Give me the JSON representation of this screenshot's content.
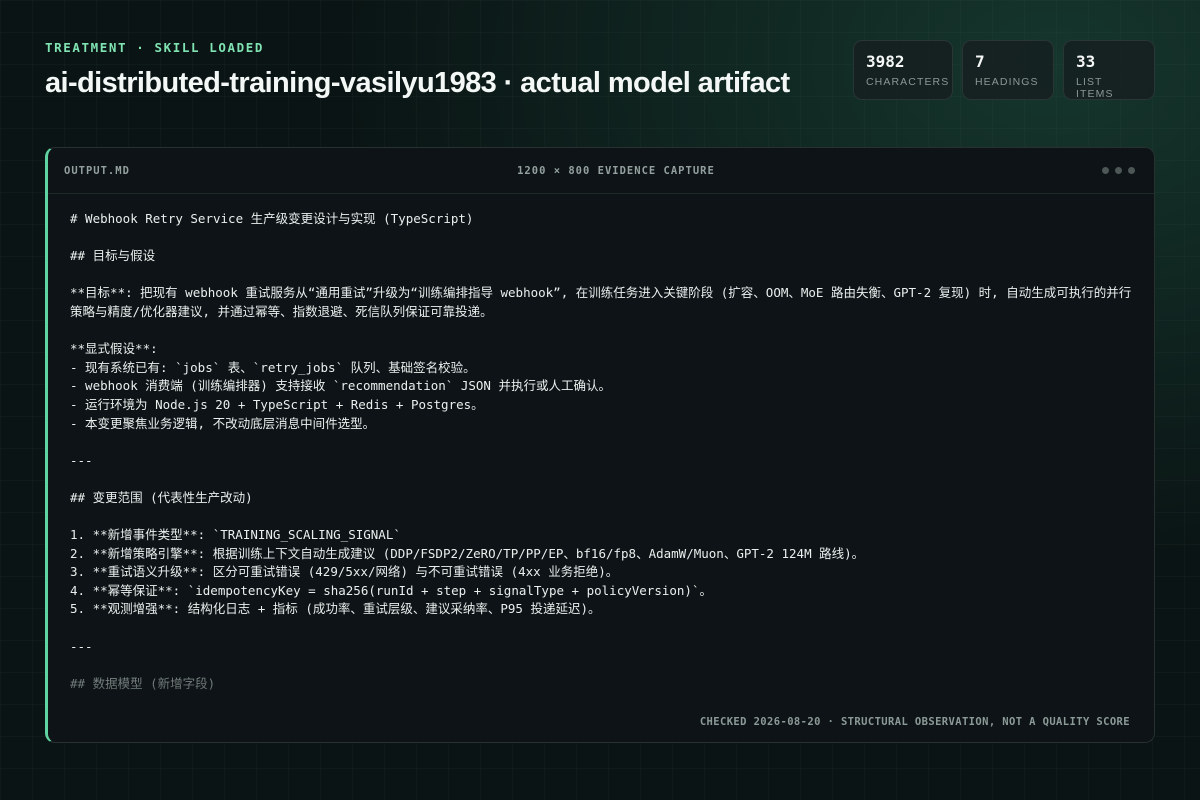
{
  "header": {
    "eyebrow": "TREATMENT · SKILL LOADED",
    "title": "ai-distributed-training-vasilyu1983 · actual model artifact"
  },
  "stats": [
    {
      "value": "3982",
      "label": "CHARACTERS"
    },
    {
      "value": "7",
      "label": "HEADINGS"
    },
    {
      "value": "33",
      "label": "LIST ITEMS"
    }
  ],
  "panel": {
    "filename": "OUTPUT.MD",
    "caption": "1200 × 800 EVIDENCE CAPTURE",
    "footer": "CHECKED 2026-08-20 · STRUCTURAL OBSERVATION, NOT A QUALITY SCORE"
  },
  "colors": {
    "accent": "#5fd3a1",
    "eyebrow": "#7fe3b2",
    "background": "#0a1414"
  },
  "icons": {
    "window_controls": "three-dots-icon"
  },
  "document_lines": [
    "# Webhook Retry Service 生产级变更设计与实现 (TypeScript)",
    "",
    "## 目标与假设",
    "",
    "**目标**: 把现有 webhook 重试服务从“通用重试”升级为“训练编排指导 webhook”, 在训练任务进入关键阶段 (扩容、OOM、MoE 路由失衡、GPT-2 复现) 时, 自动生成可执行的并行策略与精度/优化器建议, 并通过幂等、指数退避、死信队列保证可靠投递。",
    "",
    "**显式假设**:",
    "- 现有系统已有: `jobs` 表、`retry_jobs` 队列、基础签名校验。",
    "- webhook 消费端 (训练编排器) 支持接收 `recommendation` JSON 并执行或人工确认。",
    "- 运行环境为 Node.js 20 + TypeScript + Redis + Postgres。",
    "- 本变更聚焦业务逻辑, 不改动底层消息中间件选型。",
    "",
    "---",
    "",
    "## 变更范围 (代表性生产改动)",
    "",
    "1. **新增事件类型**: `TRAINING_SCALING_SIGNAL`",
    "2. **新增策略引擎**: 根据训练上下文自动生成建议 (DDP/FSDP2/ZeRO/TP/PP/EP、bf16/fp8、AdamW/Muon、GPT-2 124M 路线)。",
    "3. **重试语义升级**: 区分可重试错误 (429/5xx/网络) 与不可重试错误 (4xx 业务拒绝)。",
    "4. **幂等保证**: `idempotencyKey = sha256(runId + step + signalType + policyVersion)`。",
    "5. **观测增强**: 结构化日志 + 指标 (成功率、重试层级、建议采纳率、P95 投递延迟)。",
    "",
    "---",
    "",
    "## 数据模型 (新增字段)"
  ]
}
